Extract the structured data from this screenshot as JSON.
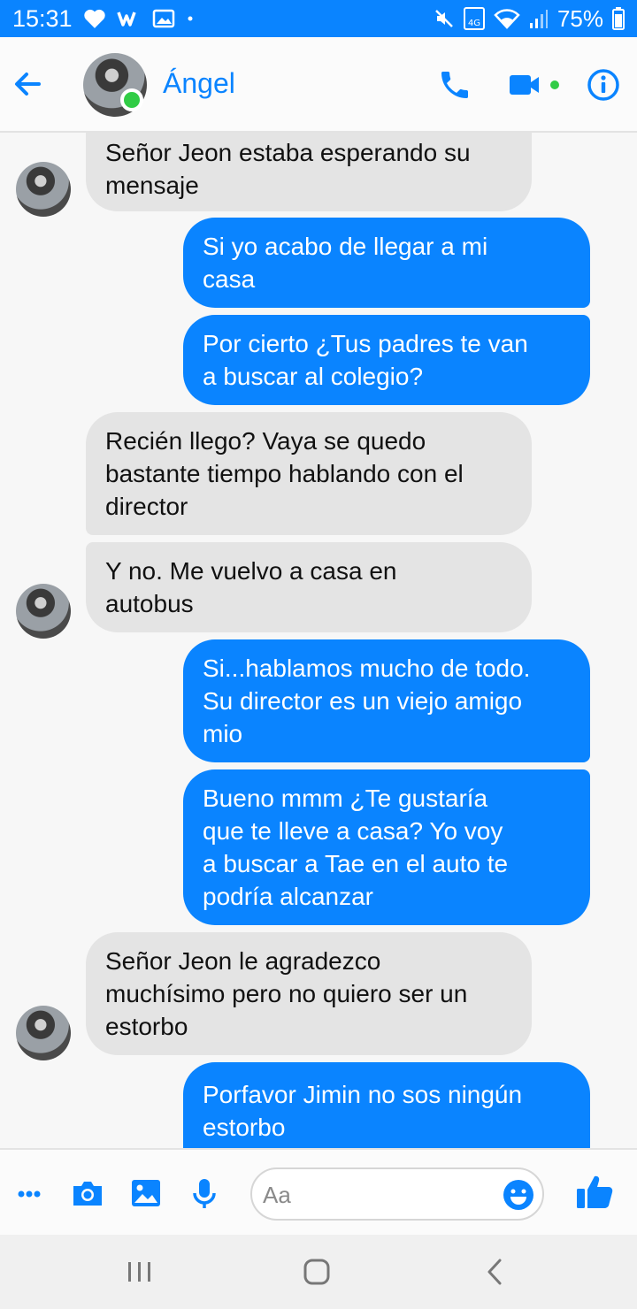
{
  "status_bar": {
    "time": "15:31",
    "battery": "75%",
    "network": "4G",
    "background_color": "#0a84ff"
  },
  "header": {
    "contact_name": "Ángel",
    "accent_color": "#0a84ff",
    "online_color": "#31cc46",
    "icons": [
      "back-arrow-icon",
      "phone-icon",
      "video-camera-icon",
      "info-icon"
    ]
  },
  "messages": [
    {
      "side": "in",
      "lines": [
        "Señor Jeon estaba esperando su",
        "mensaje"
      ]
    },
    {
      "side": "out",
      "lines": [
        "Si yo acabo de llegar a mi",
        "casa"
      ]
    },
    {
      "side": "out",
      "lines": [
        "Por cierto ¿Tus padres te van",
        "a buscar al colegio?"
      ]
    },
    {
      "side": "in",
      "lines": [
        "Recién llego? Vaya se quedo",
        "bastante tiempo hablando con el",
        "director"
      ]
    },
    {
      "side": "in",
      "lines": [
        "Y no. Me vuelvo a casa en",
        "autobus"
      ]
    },
    {
      "side": "out",
      "lines": [
        "Si...hablamos mucho de todo.",
        "Su director es un viejo amigo",
        "mio"
      ]
    },
    {
      "side": "out",
      "lines": [
        "Bueno mmm ¿Te gustaría",
        "que te lleve a casa? Yo voy",
        "a buscar a Tae en el auto te",
        "podría alcanzar"
      ]
    },
    {
      "side": "in",
      "lines": [
        "Señor Jeon le agradezco",
        "muchísimo pero no quiero ser un",
        "estorbo"
      ]
    },
    {
      "side": "out",
      "lines": [
        "Porfavor Jimin no sos ningún",
        "estorbo"
      ]
    }
  ],
  "composer": {
    "placeholder": "Aa",
    "icons": [
      "more-icon",
      "camera-icon",
      "image-icon",
      "microphone-icon",
      "emoji-icon",
      "thumbs-up-icon"
    ]
  },
  "colors": {
    "outgoing_bubble": "#0a84ff",
    "incoming_bubble": "#e4e4e4"
  }
}
